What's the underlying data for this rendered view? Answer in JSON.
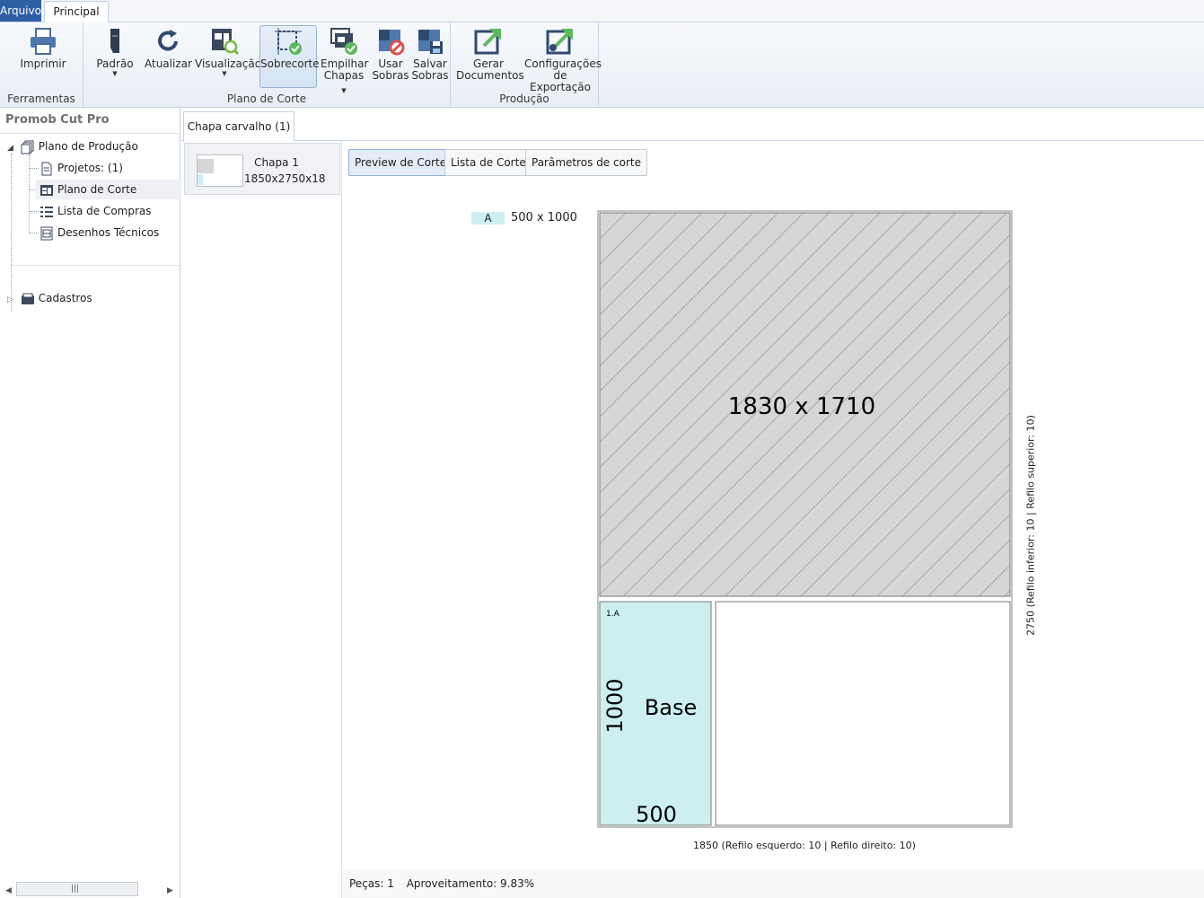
{
  "tabs": {
    "file": "Arquivo",
    "main": "Principal"
  },
  "ribbon": {
    "groups": {
      "tools": "Ferramentas",
      "plan": "Plano de Corte",
      "production": "Produção"
    },
    "buttons": {
      "print": "Imprimir",
      "standard": "Padrão",
      "refresh": "Atualizar",
      "view": "Visualização",
      "offcut": "Sobrecorte",
      "stack_line1": "Empilhar",
      "stack_line2": "Chapas",
      "use_line1": "Usar",
      "use_line2": "Sobras",
      "save_line1": "Salvar",
      "save_line2": "Sobras",
      "gen_line1": "Gerar",
      "gen_line2": "Documentos",
      "config_line1": "Configurações",
      "config_line2": "de Exportação"
    }
  },
  "nav": {
    "title": "Promob Cut Pro",
    "root": "Plano de Produção",
    "items": [
      "Projetos: (1)",
      "Plano de Corte",
      "Lista de Compras",
      "Desenhos Técnicos"
    ],
    "cadastros": "Cadastros"
  },
  "doc_tab": "Chapa carvalho  (1)",
  "sheet": {
    "name": "Chapa 1",
    "dims": "1850x2750x18"
  },
  "view_buttons": [
    "Preview de Corte",
    "Lista de Corte",
    "Parâmetros de corte"
  ],
  "legend": {
    "code": "A",
    "size": "500 x 1000"
  },
  "drawing": {
    "offcut_label": "1830 x 1710",
    "piece_id": "1.A",
    "piece_name": "Base",
    "piece_height": "1000",
    "piece_width": "500",
    "bottom_dim": "1850 (Refilo esquerdo: 10  | Refilo direito: 10)",
    "side_dim": "2750 (Refilo inferior: 10 | Refilo superior: 10)",
    "colors": {
      "piece": "#cdeff1",
      "offcut": "#d6d6d6",
      "hatch": "#9a9a9a"
    }
  },
  "status": {
    "pieces": "Peças: 1",
    "usage": "Aproveitamento: 9.83%"
  }
}
